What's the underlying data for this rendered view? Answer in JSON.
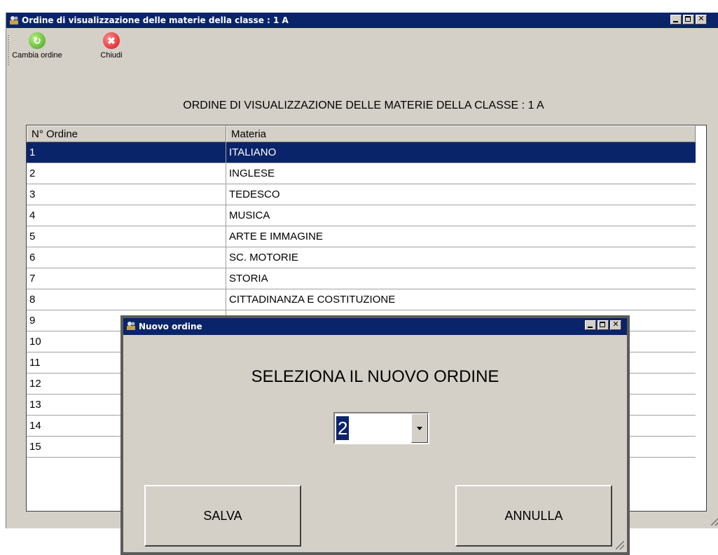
{
  "main_window": {
    "title": "Ordine di visualizzazione delle materie della classe : 1 A"
  },
  "toolbar": {
    "change_order_label": "Cambia ordine",
    "close_label": "Chiudi",
    "change_order_icon": "refresh-icon",
    "close_icon": "close-circle-icon"
  },
  "list_heading": "ORDINE DI VISUALIZZAZIONE DELLE MATERIE DELLA CLASSE : 1 A",
  "list": {
    "columns": [
      "N° Ordine",
      "Materia"
    ],
    "rows": [
      {
        "order": "1",
        "subject": "ITALIANO"
      },
      {
        "order": "2",
        "subject": "INGLESE"
      },
      {
        "order": "3",
        "subject": "TEDESCO"
      },
      {
        "order": "4",
        "subject": "MUSICA"
      },
      {
        "order": "5",
        "subject": "ARTE E IMMAGINE"
      },
      {
        "order": "6",
        "subject": "SC. MOTORIE"
      },
      {
        "order": "7",
        "subject": "STORIA"
      },
      {
        "order": "8",
        "subject": "CITTADINANZA E COSTITUZIONE"
      },
      {
        "order": "9",
        "subject": ""
      },
      {
        "order": "10",
        "subject": ""
      },
      {
        "order": "11",
        "subject": ""
      },
      {
        "order": "12",
        "subject": ""
      },
      {
        "order": "13",
        "subject": ""
      },
      {
        "order": "14",
        "subject": ""
      },
      {
        "order": "15",
        "subject": ""
      }
    ],
    "selected_index": 0
  },
  "dialog": {
    "title": "Nuovo ordine",
    "heading": "SELEZIONA IL NUOVO ORDINE",
    "selected_value": "2",
    "save_label": "SALVA",
    "cancel_label": "ANNULLA"
  },
  "colors": {
    "titlebar": "#0a246a",
    "face": "#d4d0c8",
    "selection": "#0a246a"
  }
}
